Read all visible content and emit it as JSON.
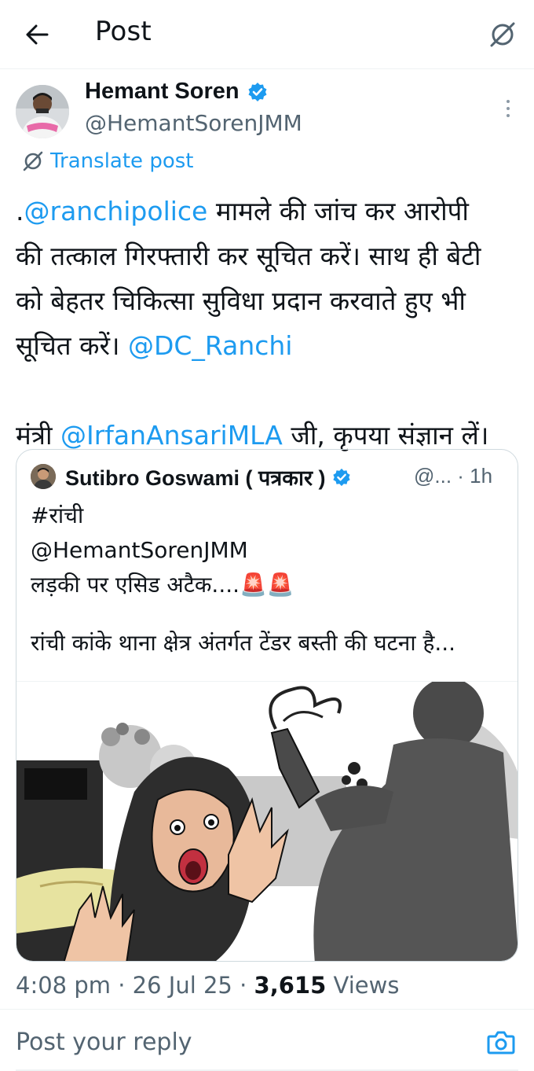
{
  "header": {
    "title": "Post",
    "back_icon": "arrow-left-icon",
    "translate_icon": "translate-slash-icon"
  },
  "post": {
    "author": {
      "name": "Hemant Soren",
      "handle": "@HemantSorenJMM",
      "verified": true
    },
    "translate_label": "Translate post",
    "body": {
      "line1_prefix": ".",
      "line1_mention": "@ranchipolice",
      "line1_rest": " मामले की जांच कर आरोपी",
      "line2": "की तत्काल गिरफ्तारी कर सूचित करें। साथ ही बेटी",
      "line3": "को बेहतर चिकित्सा सुविधा प्रदान करवाते हुए भी",
      "line4_prefix": "सूचित करें। ",
      "line4_mention": "@DC_Ranchi",
      "line6_prefix": "मंत्री ",
      "line6_mention": "@IrfanAnsariMLA",
      "line6_rest": " जी, कृपया संज्ञान लें।"
    },
    "time": "4:08 pm",
    "date": "26 Jul 25",
    "views_count": "3,615",
    "views_label": "Views"
  },
  "quote": {
    "author_name": "Sutibro Goswami ( पत्रकार )",
    "handle_time": "@... · 1h",
    "verified": true,
    "lines": [
      "#रांची",
      "@HemantSorenJMM",
      "लड़की पर एसिड अटैक....🚨🚨"
    ],
    "last_line": " रांची कांके थाना क्षेत्र अंतर्गत टेंडर बस्ती की घटना है..."
  },
  "reply": {
    "placeholder": "Post your reply",
    "camera_icon": "camera-icon"
  },
  "colors": {
    "accent": "#1d9bf0",
    "text": "#0f1419",
    "secondary": "#536471",
    "border": "#cfd9de"
  }
}
